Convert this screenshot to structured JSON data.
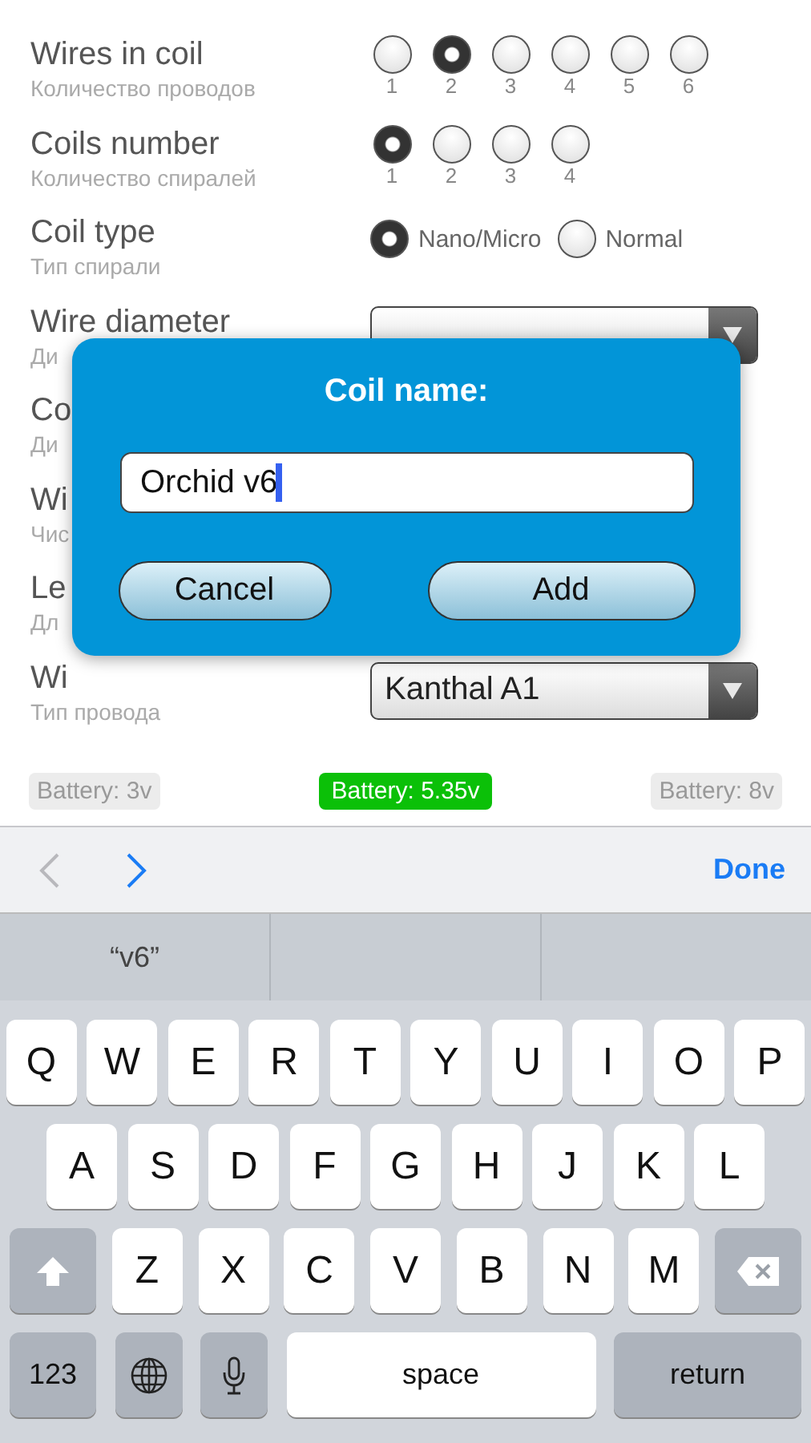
{
  "form": {
    "rows": [
      {
        "label": "Wires in coil",
        "sublabel": "Количество проводов",
        "kind": "radio_stacked",
        "options": [
          {
            "label": "1",
            "selected": false
          },
          {
            "label": "2",
            "selected": true
          },
          {
            "label": "3",
            "selected": false
          },
          {
            "label": "4",
            "selected": false
          },
          {
            "label": "5",
            "selected": false
          },
          {
            "label": "6",
            "selected": false
          }
        ]
      },
      {
        "label": "Coils number",
        "sublabel": "Количество спиралей",
        "kind": "radio_stacked",
        "options": [
          {
            "label": "1",
            "selected": true
          },
          {
            "label": "2",
            "selected": false
          },
          {
            "label": "3",
            "selected": false
          },
          {
            "label": "4",
            "selected": false
          }
        ]
      },
      {
        "label": "Coil type",
        "sublabel": "Тип спирали",
        "kind": "radio_inline",
        "options": [
          {
            "label": "Nano/Micro",
            "selected": true
          },
          {
            "label": "Normal",
            "selected": false
          }
        ]
      },
      {
        "label": "Wire diameter",
        "sublabel": "Ди",
        "kind": "dropdown"
      },
      {
        "label": "Co",
        "sublabel": "Ди",
        "kind": "plain"
      },
      {
        "label": "Wi",
        "sublabel": "Чис",
        "kind": "plain"
      },
      {
        "label": "Le",
        "sublabel": "Дл",
        "kind": "plain"
      },
      {
        "label": "Wi",
        "sublabel": "Тип провода",
        "kind": "dropdown",
        "value": "Kanthal A1"
      }
    ]
  },
  "batteries": [
    {
      "label": "Battery: 3v",
      "selected": false
    },
    {
      "label": "Battery: 5.35v",
      "selected": true
    },
    {
      "label": "Battery: 8v",
      "selected": false
    }
  ],
  "dialog": {
    "title": "Coil name:",
    "value": "Orchid v6",
    "buttons": [
      "Cancel",
      "Add"
    ]
  },
  "keyboard": {
    "done": "Done",
    "suggestions": [
      "“v6”"
    ],
    "rows": [
      {
        "keys": [
          {
            "kind": "letter",
            "label": "Q"
          },
          {
            "kind": "letter",
            "label": "W"
          },
          {
            "kind": "letter",
            "label": "E"
          },
          {
            "kind": "letter",
            "label": "R"
          },
          {
            "kind": "letter",
            "label": "T"
          },
          {
            "kind": "letter",
            "label": "Y"
          },
          {
            "kind": "letter",
            "label": "U"
          },
          {
            "kind": "letter",
            "label": "I"
          },
          {
            "kind": "letter",
            "label": "O"
          },
          {
            "kind": "letter",
            "label": "P"
          }
        ]
      },
      {
        "keys": [
          {
            "kind": "letter",
            "label": "A"
          },
          {
            "kind": "letter",
            "label": "S"
          },
          {
            "kind": "letter",
            "label": "D"
          },
          {
            "kind": "letter",
            "label": "F"
          },
          {
            "kind": "letter",
            "label": "G"
          },
          {
            "kind": "letter",
            "label": "H"
          },
          {
            "kind": "letter",
            "label": "J"
          },
          {
            "kind": "letter",
            "label": "K"
          },
          {
            "kind": "letter",
            "label": "L"
          }
        ]
      },
      {
        "keys": [
          {
            "kind": "shift"
          },
          {
            "kind": "letter",
            "label": "Z"
          },
          {
            "kind": "letter",
            "label": "X"
          },
          {
            "kind": "letter",
            "label": "C"
          },
          {
            "kind": "letter",
            "label": "V"
          },
          {
            "kind": "letter",
            "label": "B"
          },
          {
            "kind": "letter",
            "label": "N"
          },
          {
            "kind": "letter",
            "label": "M"
          },
          {
            "kind": "delete"
          }
        ]
      },
      {
        "keys": [
          {
            "kind": "mode",
            "label": "123"
          },
          {
            "kind": "globe"
          },
          {
            "kind": "mic"
          },
          {
            "kind": "space",
            "label": "space"
          },
          {
            "kind": "return",
            "label": "return"
          }
        ]
      }
    ]
  }
}
